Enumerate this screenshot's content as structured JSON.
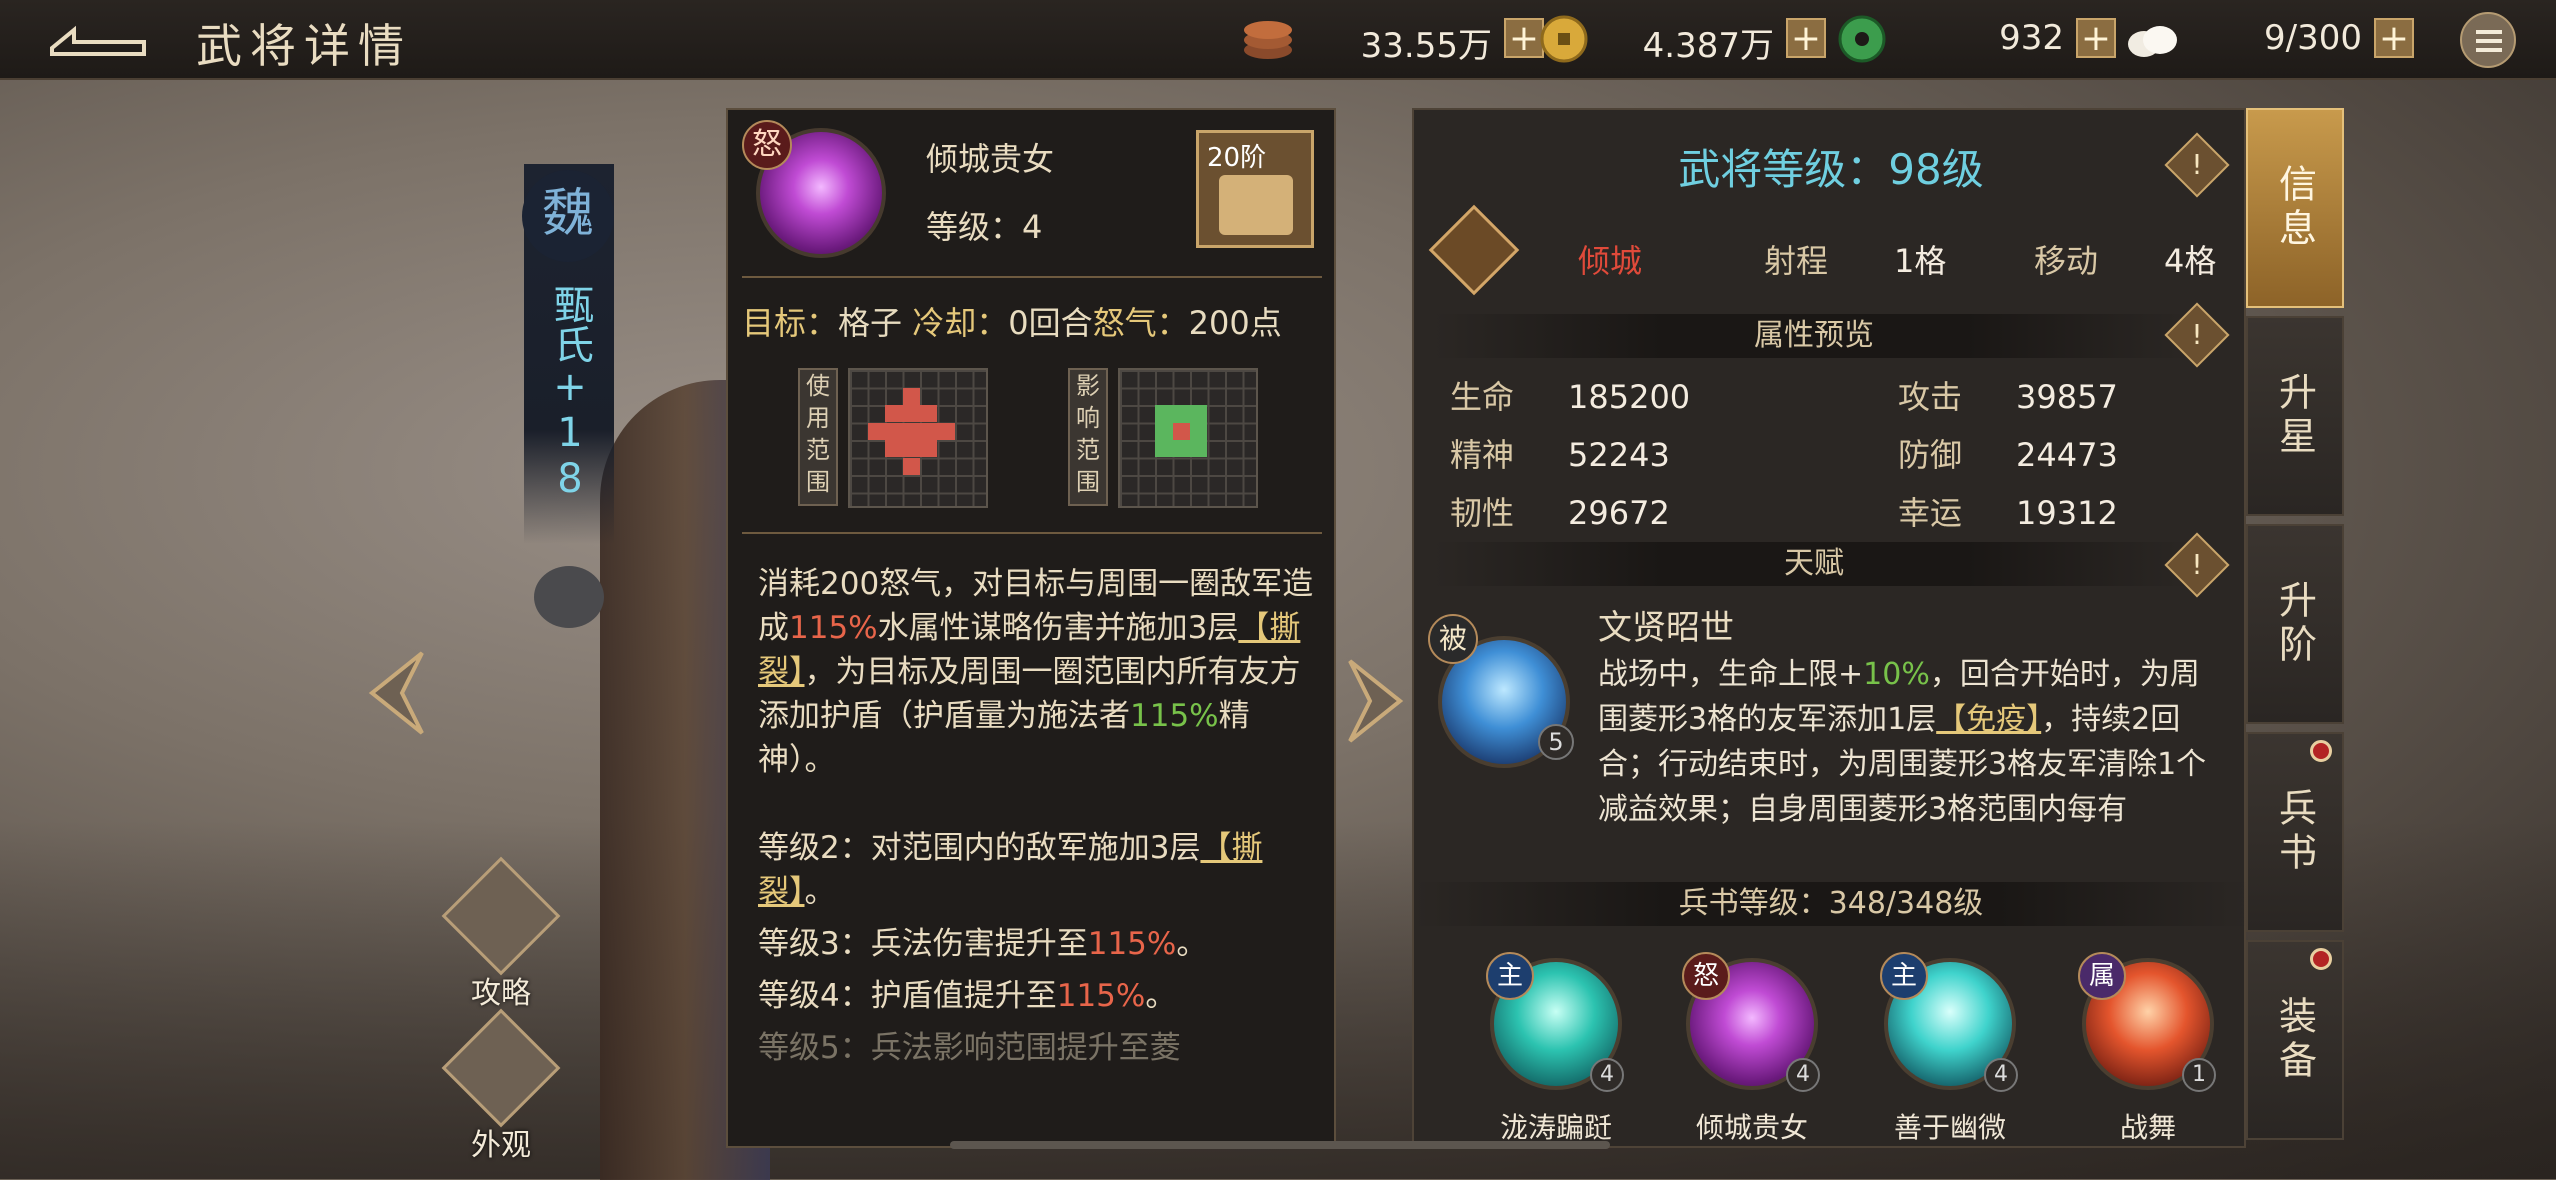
{
  "header": {
    "title": "武将详情",
    "resources": [
      {
        "icon": "copper-coins-icon",
        "amount": "33.55万"
      },
      {
        "icon": "gold-coin-icon",
        "amount": "4.387万"
      },
      {
        "icon": "jade-icon",
        "amount": "932"
      },
      {
        "icon": "steamed-bun-icon",
        "amount": "9/300"
      }
    ]
  },
  "hero": {
    "faction": "魏",
    "name": "甄氏",
    "enhance": "+18"
  },
  "side_buttons": {
    "strategy": "攻略",
    "appearance": "外观"
  },
  "skill_popup": {
    "badge": "怒",
    "name": "倾城贵女",
    "level": "等级：4",
    "rank": "20阶",
    "target_label": "目标：",
    "target_value": "格子",
    "cooldown_label": "冷却：",
    "cooldown_value": "0回合",
    "rage_label": "怒气：",
    "rage_value": "200点",
    "use_range_label": "使用范围",
    "effect_range_label": "影响范围",
    "desc": {
      "p1_a": "消耗200怒气，对目标与周围一圈敌军造成",
      "p1_pct": "115%",
      "p1_b": "水属性谋略伤害并施加3层",
      "p1_tag": "【撕裂】",
      "p1_c": "，为目标及周围一圈范围内所有友方添加护盾（护盾量为施法者",
      "p1_pct2": "115%",
      "p1_d": "精神）。",
      "lv2_a": "等级2：对范围内的敌军施加3层",
      "lv2_tag": "【撕裂】",
      "lv2_b": "。",
      "lv3_a": "等级3：兵法伤害提升至",
      "lv3_pct": "115%",
      "lv3_b": "。",
      "lv4_a": "等级4：护盾值提升至",
      "lv4_pct": "115%",
      "lv4_b": "。",
      "lv5": "等级5：兵法影响范围提升至菱"
    }
  },
  "info_panel": {
    "level_text": "武将等级：98级",
    "hero_type": "倾城",
    "range_label": "射程",
    "range_value": "1格",
    "move_label": "移动",
    "move_value": "4格",
    "attr_title": "属性预览",
    "attrs": [
      {
        "label": "生命",
        "value": "185200"
      },
      {
        "label": "攻击",
        "value": "39857"
      },
      {
        "label": "精神",
        "value": "52243"
      },
      {
        "label": "防御",
        "value": "24473"
      },
      {
        "label": "韧性",
        "value": "29672"
      },
      {
        "label": "幸运",
        "value": "19312"
      }
    ],
    "talent_title": "天赋",
    "talent": {
      "badge": "被",
      "level": "5",
      "name": "文贤昭世",
      "d1": "战场中，生命上限+",
      "d1_pct": "10%",
      "d2": "，回合开始时，为周围菱形3格的友军添加1层",
      "d3_tag": "【免疫】",
      "d4": "，持续2回合；行动结束时，为周围菱形3格友军清除1个减益效果；自身周围菱形3格范围内每有"
    },
    "bingshu_text": "兵书等级：348/348级",
    "skills": [
      {
        "badge": "主",
        "name": "泷涛蹁跹",
        "level": "4"
      },
      {
        "badge": "怒",
        "name": "倾城贵女",
        "level": "4"
      },
      {
        "badge": "主",
        "name": "善于幽微",
        "level": "4"
      },
      {
        "badge": "属",
        "name": "战舞",
        "level": "1"
      }
    ]
  },
  "tabs": [
    {
      "label": "信息"
    },
    {
      "label": "升星"
    },
    {
      "label": "升阶"
    },
    {
      "label": "兵书"
    },
    {
      "label": "装备"
    }
  ]
}
